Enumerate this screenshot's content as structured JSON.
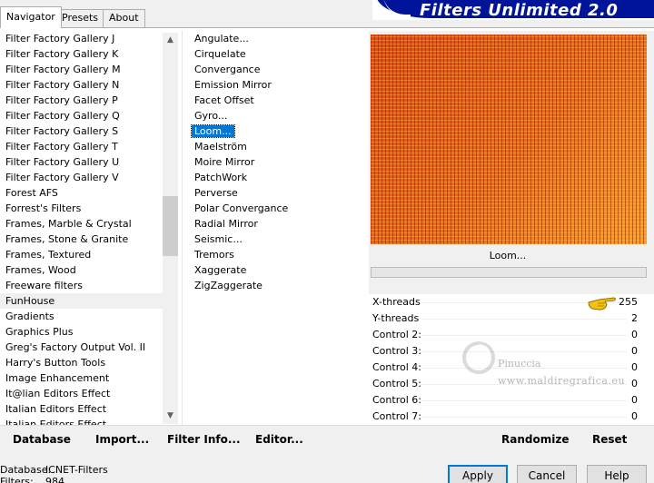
{
  "tabs": [
    "Navigator",
    "Presets",
    "About"
  ],
  "app_title": "Filters Unlimited 2.0",
  "categories": [
    "Filter Factory Gallery J",
    "Filter Factory Gallery K",
    "Filter Factory Gallery M",
    "Filter Factory Gallery N",
    "Filter Factory Gallery P",
    "Filter Factory Gallery Q",
    "Filter Factory Gallery S",
    "Filter Factory Gallery T",
    "Filter Factory Gallery U",
    "Filter Factory Gallery V",
    "Forest AFS",
    "Forrest's Filters",
    "Frames, Marble & Crystal",
    "Frames, Stone & Granite",
    "Frames, Textured",
    "Frames, Wood",
    "Freeware filters",
    "FunHouse",
    "Gradients",
    "Graphics Plus",
    "Greg's Factory Output Vol. II",
    "Harry's Button Tools",
    "Image Enhancement",
    "It@lian Editors Effect",
    "Italian Editors Effect",
    "Italian Editors Effect"
  ],
  "selected_category": "FunHouse",
  "filters": [
    "Angulate...",
    "Cirquelate",
    "Convergance",
    "Emission Mirror",
    "Facet Offset",
    "Gyro...",
    "Loom...",
    "Maelström",
    "Moire Mirror",
    "PatchWork",
    "Perverse",
    "Polar Convergance",
    "Radial Mirror",
    "Seismic...",
    "Tremors",
    "Xaggerate",
    "ZigZaggerate"
  ],
  "selected_filter": "Loom...",
  "preview_label": "Loom...",
  "params": [
    {
      "name": "X-threads",
      "value": "255"
    },
    {
      "name": "Y-threads",
      "value": "2"
    },
    {
      "name": "Control 2:",
      "value": "0"
    },
    {
      "name": "Control 3:",
      "value": "0"
    },
    {
      "name": "Control 4:",
      "value": "0"
    },
    {
      "name": "Control 5:",
      "value": "0"
    },
    {
      "name": "Control 6:",
      "value": "0"
    },
    {
      "name": "Control 7:",
      "value": "0"
    }
  ],
  "bottom_buttons": {
    "database": "Database",
    "import": "Import...",
    "filter_info": "Filter Info...",
    "editor": "Editor...",
    "randomize": "Randomize",
    "reset": "Reset"
  },
  "status": {
    "database_label": "Database:",
    "database_value": "ICNET-Filters",
    "filters_label": "Filters:",
    "filters_value": "984"
  },
  "dialog_buttons": {
    "apply": "Apply",
    "cancel": "Cancel",
    "help": "Help"
  },
  "watermark": {
    "name": "Pinuccia",
    "url": "www.maldiregrafica.eu"
  },
  "colors": {
    "selection": "#0078d7",
    "banner": "#00149a",
    "preview_base": "#e06018"
  }
}
